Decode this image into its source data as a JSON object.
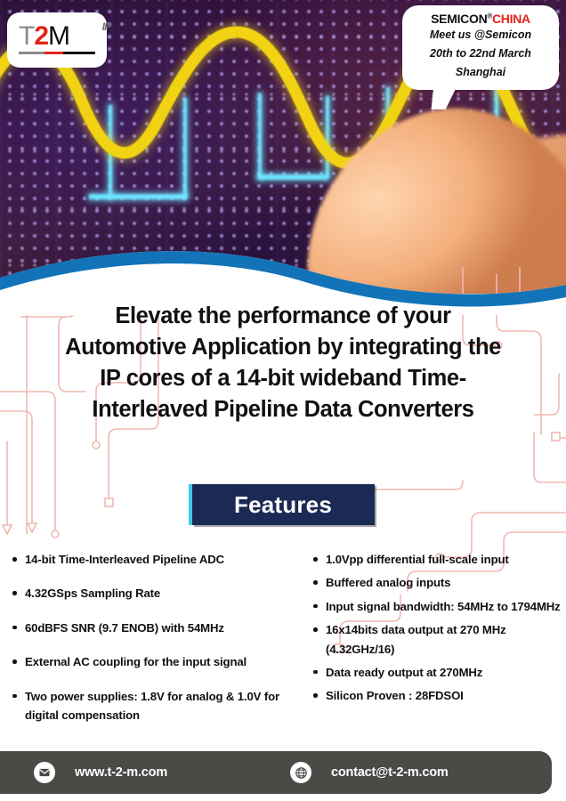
{
  "logo": {
    "letter_t": "T",
    "letter_2": "2",
    "letter_m": "M",
    "superscript": "IP",
    "name": "T2M IP"
  },
  "bubble": {
    "brand_main": "SEMICON",
    "brand_registered": "®",
    "brand_region": "CHINA",
    "lines": [
      "Meet us @Semicon",
      "20th to 22nd March",
      "Shanghai"
    ]
  },
  "headline": {
    "lines": [
      "Elevate the performance of your",
      "Automotive Application by integrating the",
      "IP cores of a 14-bit wideband Time-",
      "Interleaved Pipeline Data Converters"
    ]
  },
  "features": {
    "banner_label": "Features",
    "left_column": [
      "14-bit Time-Interleaved Pipeline ADC",
      "4.32GSps Sampling Rate",
      "60dBFS SNR (9.7 ENOB) with 54MHz",
      "External AC coupling for the input signal",
      "Two power supplies: 1.8V for analog & 1.0V for digital compensation"
    ],
    "right_column": [
      "1.0Vpp differential full-scale input",
      "Buffered analog inputs",
      "Input signal bandwidth: 54MHz to 1794MHz",
      "16x14bits data output at 270 MHz (4.32GHz/16)",
      "Data ready output at 270MHz",
      "Silicon Proven : 28FDSOI"
    ]
  },
  "footer": {
    "website_icon": "envelope-icon",
    "website": "www.t-2-m.com",
    "email_icon": "globe-icon",
    "email": "contact@t-2-m.com"
  },
  "colors": {
    "wave_blue": "#1273b8",
    "banner_navy": "#1b2a54",
    "banner_accent_cyan": "#3ec6e8",
    "brand_red": "#e2231a",
    "footer_gray": "#4c4a47",
    "trace_pink": "#f2b8b2",
    "sine_yellow": "#f2d313",
    "square_cyan": "#6de4ff"
  }
}
